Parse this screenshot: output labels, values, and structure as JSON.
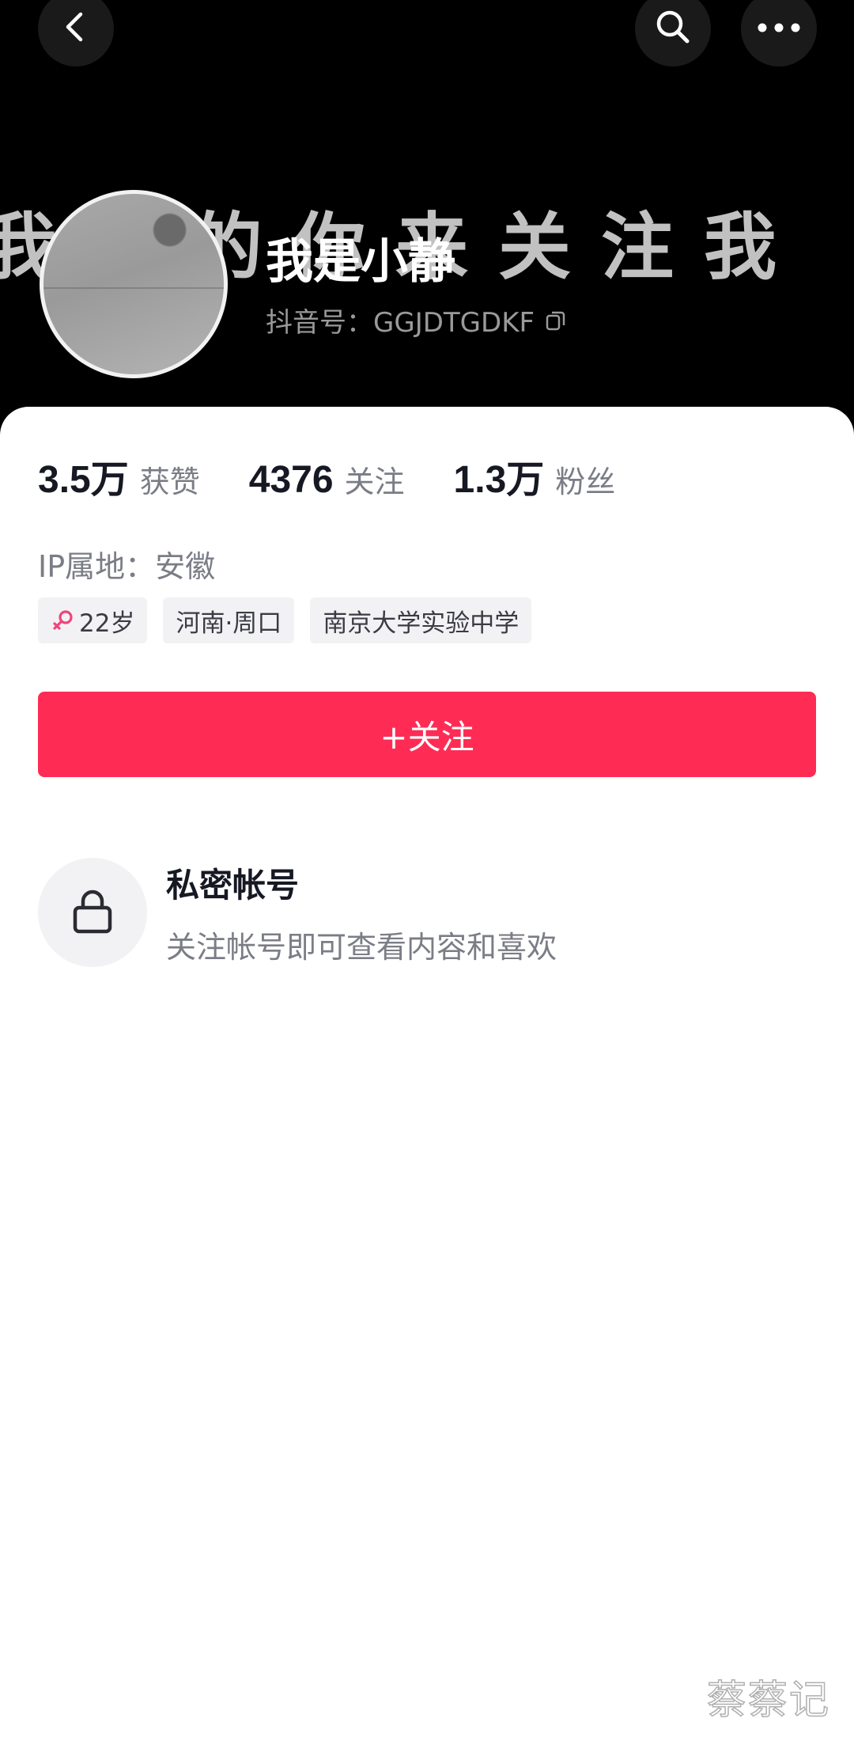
{
  "header": {
    "banner_text": "我秀的你来关注我",
    "username": "我是小静",
    "douyin_id": "抖音号：GGJDTGDKF"
  },
  "stats": [
    {
      "value": "3.5万",
      "label": "获赞"
    },
    {
      "value": "4376",
      "label": "关注"
    },
    {
      "value": "1.3万",
      "label": "粉丝"
    }
  ],
  "ip_location": "IP属地：安徽",
  "tags": {
    "age": "22岁",
    "location": "河南·周口",
    "school": "南京大学实验中学"
  },
  "follow_button": "+关注",
  "private_account": {
    "title": "私密帐号",
    "description": "关注帐号即可查看内容和喜欢"
  },
  "watermark": "蔡蔡记",
  "colors": {
    "accent": "#fe2c55",
    "gender_female": "#f0447a",
    "header_bg": "#000000"
  },
  "icons": [
    "back-arrow-icon",
    "search-icon",
    "more-icon",
    "copy-icon",
    "female-icon",
    "lock-icon"
  ]
}
